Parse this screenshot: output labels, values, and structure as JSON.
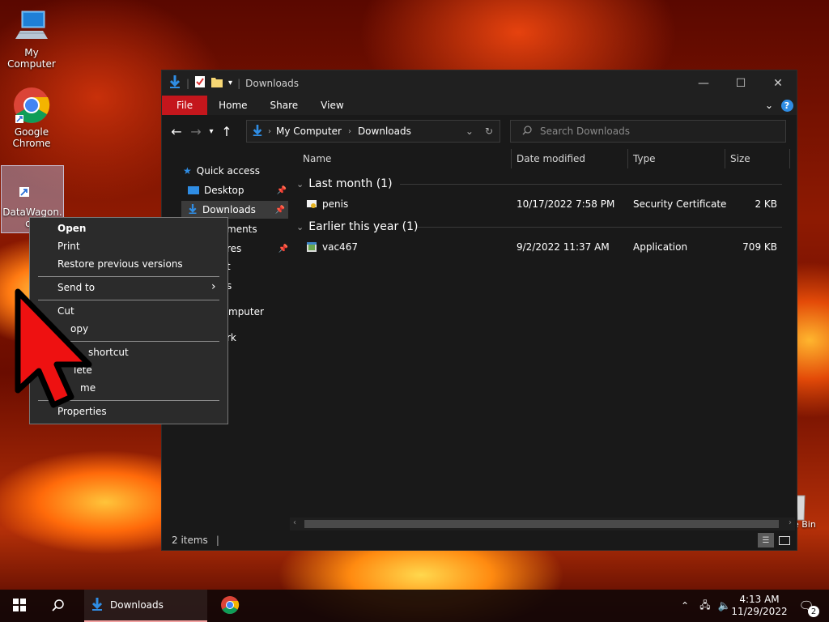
{
  "desktop": {
    "icons": [
      {
        "label": "My Computer"
      },
      {
        "label": "Google Chrome"
      },
      {
        "label": "DataWagon.c o"
      }
    ],
    "recycle_label": "e Bin"
  },
  "explorer": {
    "title": "Downloads",
    "ribbon_tabs": [
      "File",
      "Home",
      "Share",
      "View"
    ],
    "address_path": [
      "My Computer",
      "Downloads"
    ],
    "search_placeholder": "Search Downloads",
    "nav_items": [
      {
        "label": "Quick access"
      },
      {
        "label": "Desktop"
      },
      {
        "label": "Downloads"
      },
      {
        "label": "ments"
      },
      {
        "label": "res"
      },
      {
        "label": "t"
      },
      {
        "label": "s"
      },
      {
        "label": "mputer"
      },
      {
        "label": "rk"
      }
    ],
    "columns": {
      "name": "Name",
      "date": "Date modified",
      "type": "Type",
      "size": "Size"
    },
    "groups": [
      {
        "label": "Last month (1)",
        "files": [
          {
            "name": "penis",
            "date": "10/17/2022 7:58 PM",
            "type": "Security Certificate",
            "size": "2 KB"
          }
        ]
      },
      {
        "label": "Earlier this year (1)",
        "files": [
          {
            "name": "vac467",
            "date": "9/2/2022 11:37 AM",
            "type": "Application",
            "size": "709 KB"
          }
        ]
      }
    ],
    "status": "2 items"
  },
  "context_menu": {
    "items": [
      "Open",
      "Print",
      "Restore previous versions",
      "Send to",
      "Cut",
      "opy",
      "shortcut",
      "lete",
      "me",
      "Properties"
    ]
  },
  "taskbar": {
    "active_app": "Downloads",
    "time": "4:13 AM",
    "date": "11/29/2022",
    "notifications": "2"
  },
  "colors": {
    "accent_file_tab": "#c4161c",
    "download_blue": "#2f8de4"
  }
}
